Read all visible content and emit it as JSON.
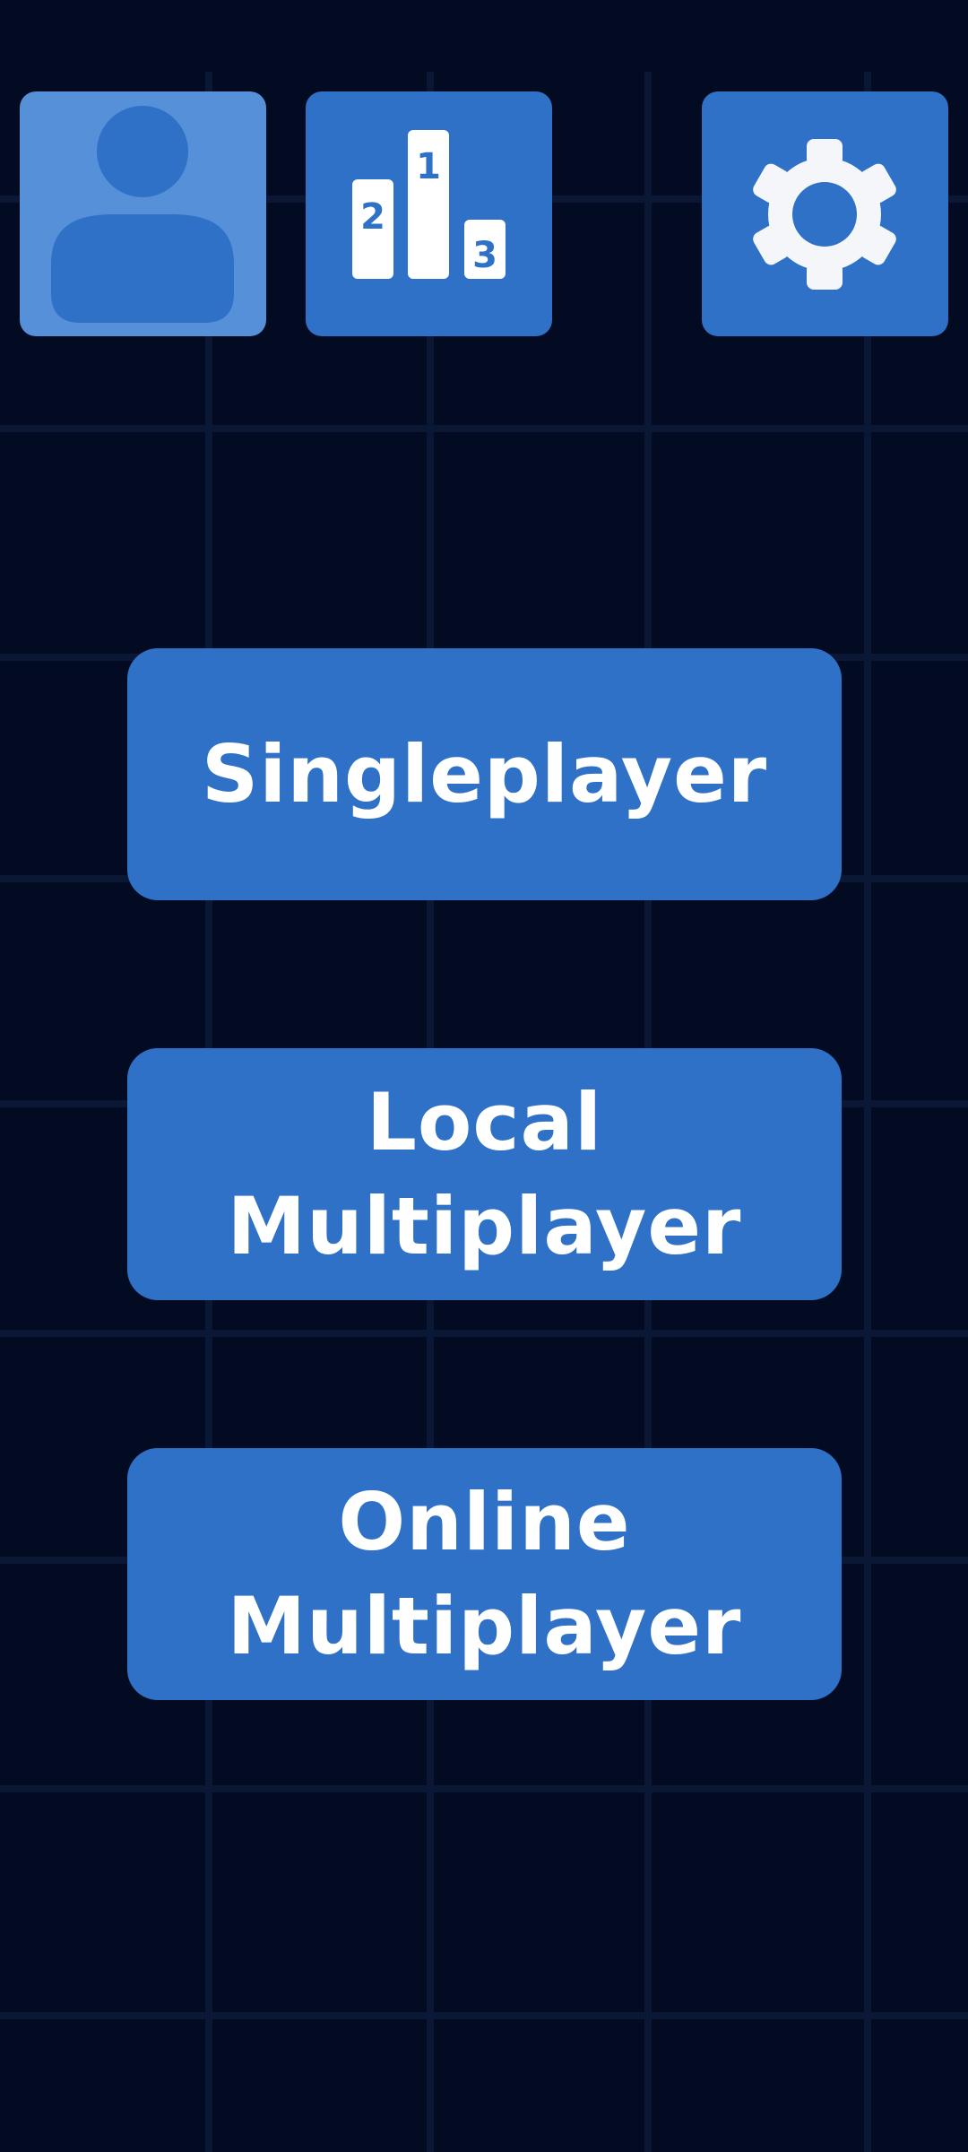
{
  "theme": {
    "background": "#020b22",
    "grid_line": "#0b1835",
    "button": "#2f71c7",
    "profile_button": "#5590d9",
    "text": "#ffffff"
  },
  "top_bar": {
    "profile_icon": "user-avatar-icon",
    "leaderboard_icon": "podium-icon",
    "leaderboard_ranks": [
      "1",
      "2",
      "3"
    ],
    "settings_icon": "gear-icon"
  },
  "menu": {
    "singleplayer_label": "Singleplayer",
    "local_multiplayer_label": "Local\nMultiplayer",
    "online_multiplayer_label": "Online\nMultiplayer"
  }
}
